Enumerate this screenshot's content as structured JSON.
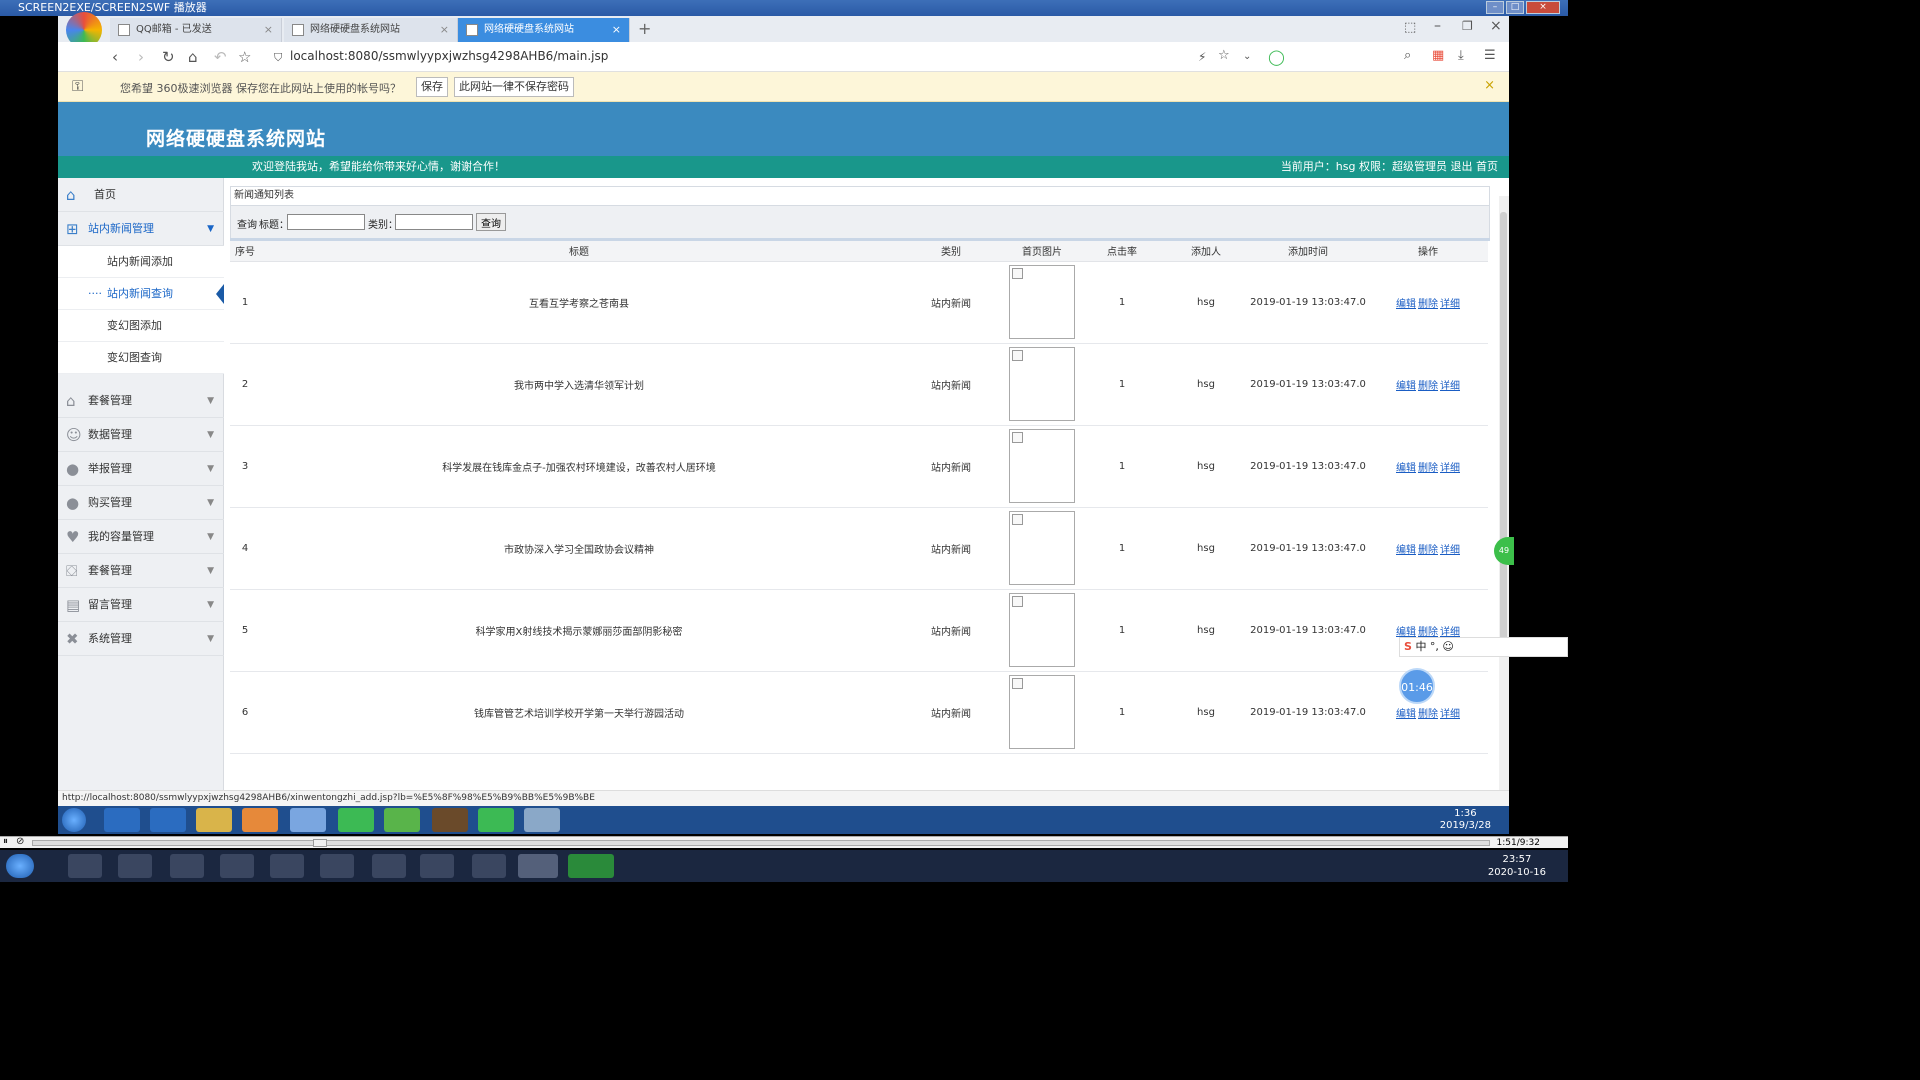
{
  "player": {
    "title": "SCREEN2EXE/SCREEN2SWF 播放器",
    "time": "1:51/9:32"
  },
  "browser": {
    "tabs": [
      {
        "label": "QQ邮箱 - 已发送"
      },
      {
        "label": "网络硬硬盘系统网站"
      },
      {
        "label": "网络硬硬盘系统网站"
      }
    ],
    "new_tab": "+",
    "url": "localhost:8080/ssmwlyypxjwzhsg4298AHB6/main.jsp",
    "infobar": {
      "message": "您希望 360极速浏览器 保存您在此网站上使用的帐号吗？",
      "save": "保存",
      "never": "此网站一律不保存密码",
      "close": "×"
    },
    "status_url": "http://localhost:8080/ssmwlyypxjwzhsg4298AHB6/xinwentongzhi_add.jsp?lb=%E5%8F%98%E5%B9%BB%E5%9B%BE"
  },
  "site": {
    "title": "网络硬硬盘系统网站",
    "welcome": "欢迎登陆我站，希望能给你带来好心情，谢谢合作！",
    "userinfo": "当前用户：hsg  权限：超级管理员 退出 首页"
  },
  "sidebar": {
    "home": "首页",
    "groups": [
      {
        "label": "站内新闻管理",
        "icon": "grid-icon"
      },
      {
        "label": "套餐管理",
        "icon": "house-icon"
      },
      {
        "label": "数据管理",
        "icon": "users-icon"
      },
      {
        "label": "举报管理",
        "icon": "user-icon"
      },
      {
        "label": "购买管理",
        "icon": "user-icon"
      },
      {
        "label": "我的容量管理",
        "icon": "heart-icon"
      },
      {
        "label": "套餐管理",
        "icon": "basket-icon"
      },
      {
        "label": "留言管理",
        "icon": "form-icon"
      },
      {
        "label": "系统管理",
        "icon": "tools-icon"
      }
    ],
    "subitems": [
      {
        "label": "站内新闻添加"
      },
      {
        "label": "站内新闻查询"
      },
      {
        "label": "变幻图添加"
      },
      {
        "label": "变幻图查询"
      }
    ]
  },
  "content": {
    "breadcrumb": "新闻通知列表",
    "search": {
      "query_label": "查询",
      "title_label": "标题：",
      "category_label": "类别：",
      "button": "查询",
      "title_value": "",
      "category_value": ""
    },
    "columns": [
      "序号",
      "标题",
      "类别",
      "首页图片",
      "点击率",
      "添加人",
      "添加时间",
      "操作"
    ],
    "actions": [
      "编辑",
      "删除",
      "详细"
    ],
    "rows": [
      {
        "id": "1",
        "title": "互看互学考察之苍南县",
        "category": "站内新闻",
        "clicks": "1",
        "adder": "hsg",
        "time": "2019-01-19 13:03:47.0"
      },
      {
        "id": "2",
        "title": "我市两中学入选清华领军计划",
        "category": "站内新闻",
        "clicks": "1",
        "adder": "hsg",
        "time": "2019-01-19 13:03:47.0"
      },
      {
        "id": "3",
        "title": "科学发展在钱库金点子-加强农村环境建设，改善农村人居环境",
        "category": "站内新闻",
        "clicks": "1",
        "adder": "hsg",
        "time": "2019-01-19 13:03:47.0"
      },
      {
        "id": "4",
        "title": "市政协深入学习全国政协会议精神",
        "category": "站内新闻",
        "clicks": "1",
        "adder": "hsg",
        "time": "2019-01-19 13:03:47.0"
      },
      {
        "id": "5",
        "title": "科学家用X射线技术揭示蒙娜丽莎面部阴影秘密",
        "category": "站内新闻",
        "clicks": "1",
        "adder": "hsg",
        "time": "2019-01-19 13:03:47.0"
      },
      {
        "id": "6",
        "title": "钱库管管艺术培训学校开学第一天举行游园活动",
        "category": "站内新闻",
        "clicks": "1",
        "adder": "hsg",
        "time": "2019-01-19 13:03:47.0"
      }
    ]
  },
  "overlays": {
    "timer": "01:46",
    "ime": "中 °, ☺",
    "ball": "49"
  },
  "inner_taskbar": {
    "time": "1:36",
    "date": "2019/3/28"
  },
  "outer_taskbar": {
    "time": "23:57",
    "date": "2020-10-16"
  },
  "colors": {
    "header": "#3b8abf",
    "welcomebar": "#19978b",
    "active_tab": "#3b8de0",
    "link": "#1a5dc4"
  }
}
